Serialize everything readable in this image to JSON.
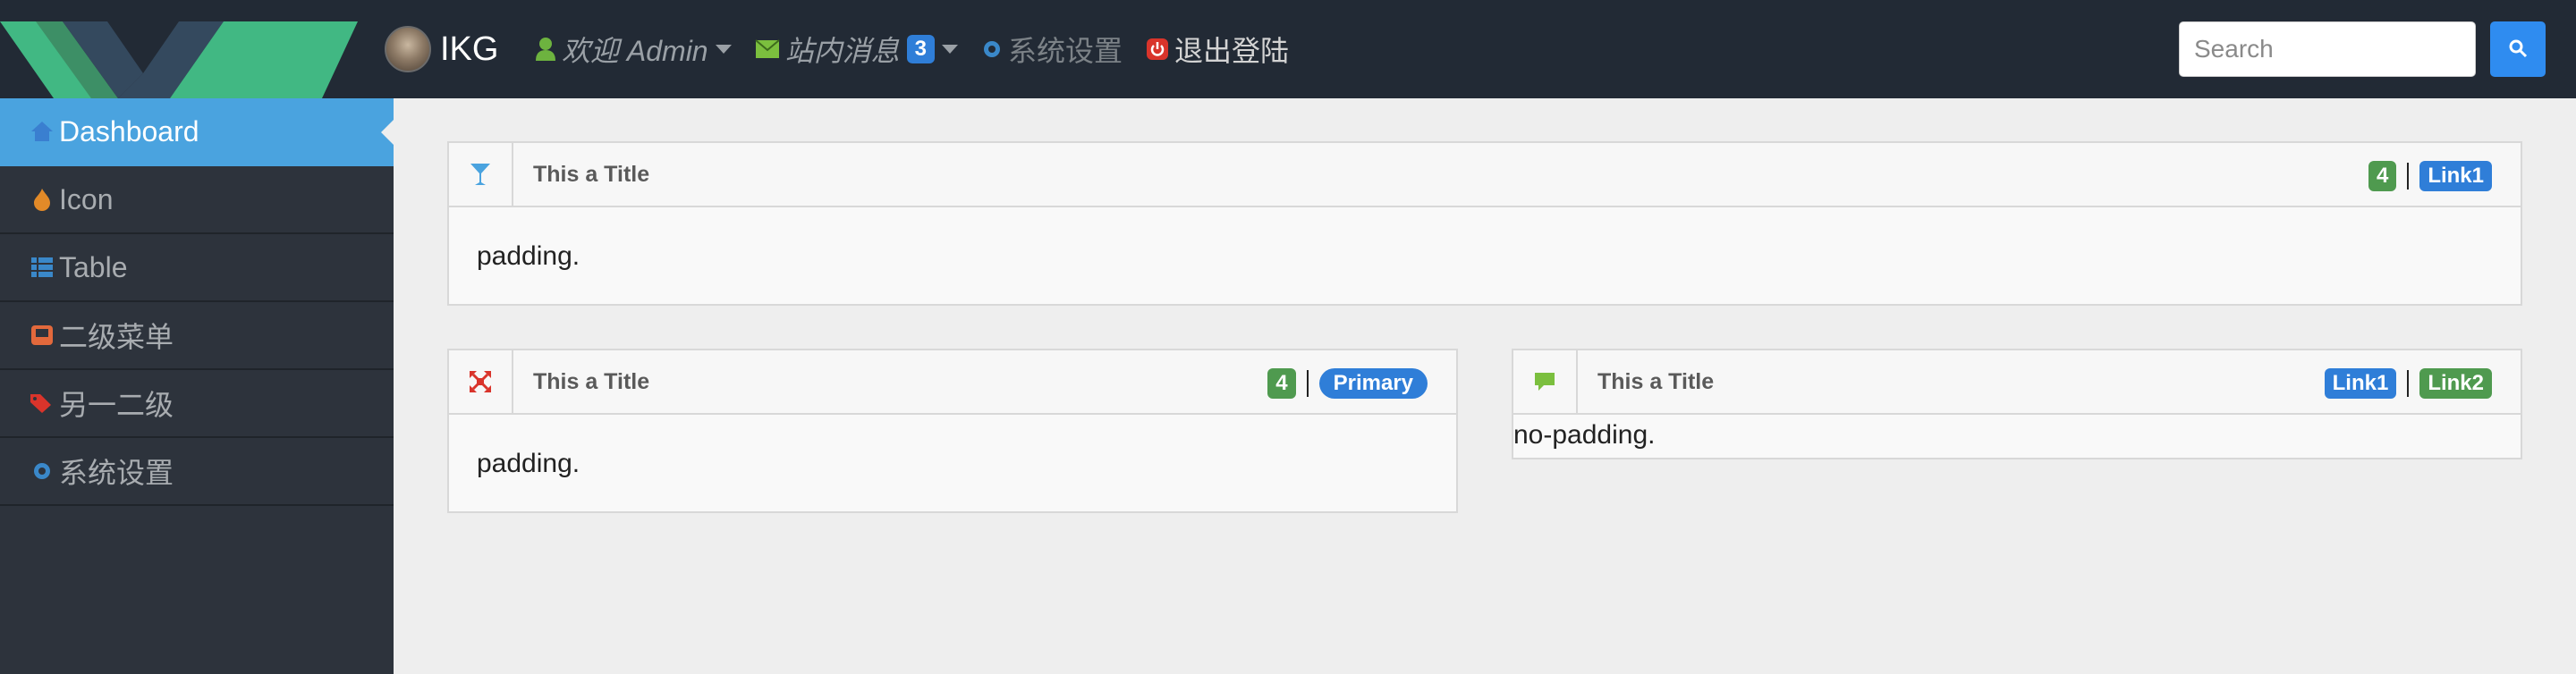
{
  "navbar": {
    "brand": "IKG",
    "welcome": "欢迎 Admin",
    "messages": "站内消息",
    "messages_count": "3",
    "settings": "系统设置",
    "logout": "退出登陆",
    "search_placeholder": "Search"
  },
  "sidebar": {
    "items": [
      {
        "label": "Dashboard",
        "icon": "home-icon",
        "active": true
      },
      {
        "label": "Icon",
        "icon": "fire-icon"
      },
      {
        "label": "Table",
        "icon": "th-list-icon"
      },
      {
        "label": "二级菜单",
        "icon": "inbox-icon"
      },
      {
        "label": "另一二级",
        "icon": "tags-icon"
      },
      {
        "label": "系统设置",
        "icon": "cog-icon"
      }
    ]
  },
  "panels": [
    {
      "title": "This a Title",
      "icon": "glass-icon",
      "count": "4",
      "link": "Link1",
      "body": "padding."
    },
    {
      "title": "This a Title",
      "icon": "fullscreen-icon",
      "count": "4",
      "link": "Primary",
      "body": "padding."
    },
    {
      "title": "This a Title",
      "icon": "comment-icon",
      "link1": "Link1",
      "link2": "Link2",
      "body": "no-padding."
    }
  ],
  "colors": {
    "navbar_bg": "#222a35",
    "sidebar_bg": "#2d333c",
    "active_item": "#4aa3df",
    "accent_blue": "#2f7ed8",
    "badge_green": "#4f9a4f"
  }
}
